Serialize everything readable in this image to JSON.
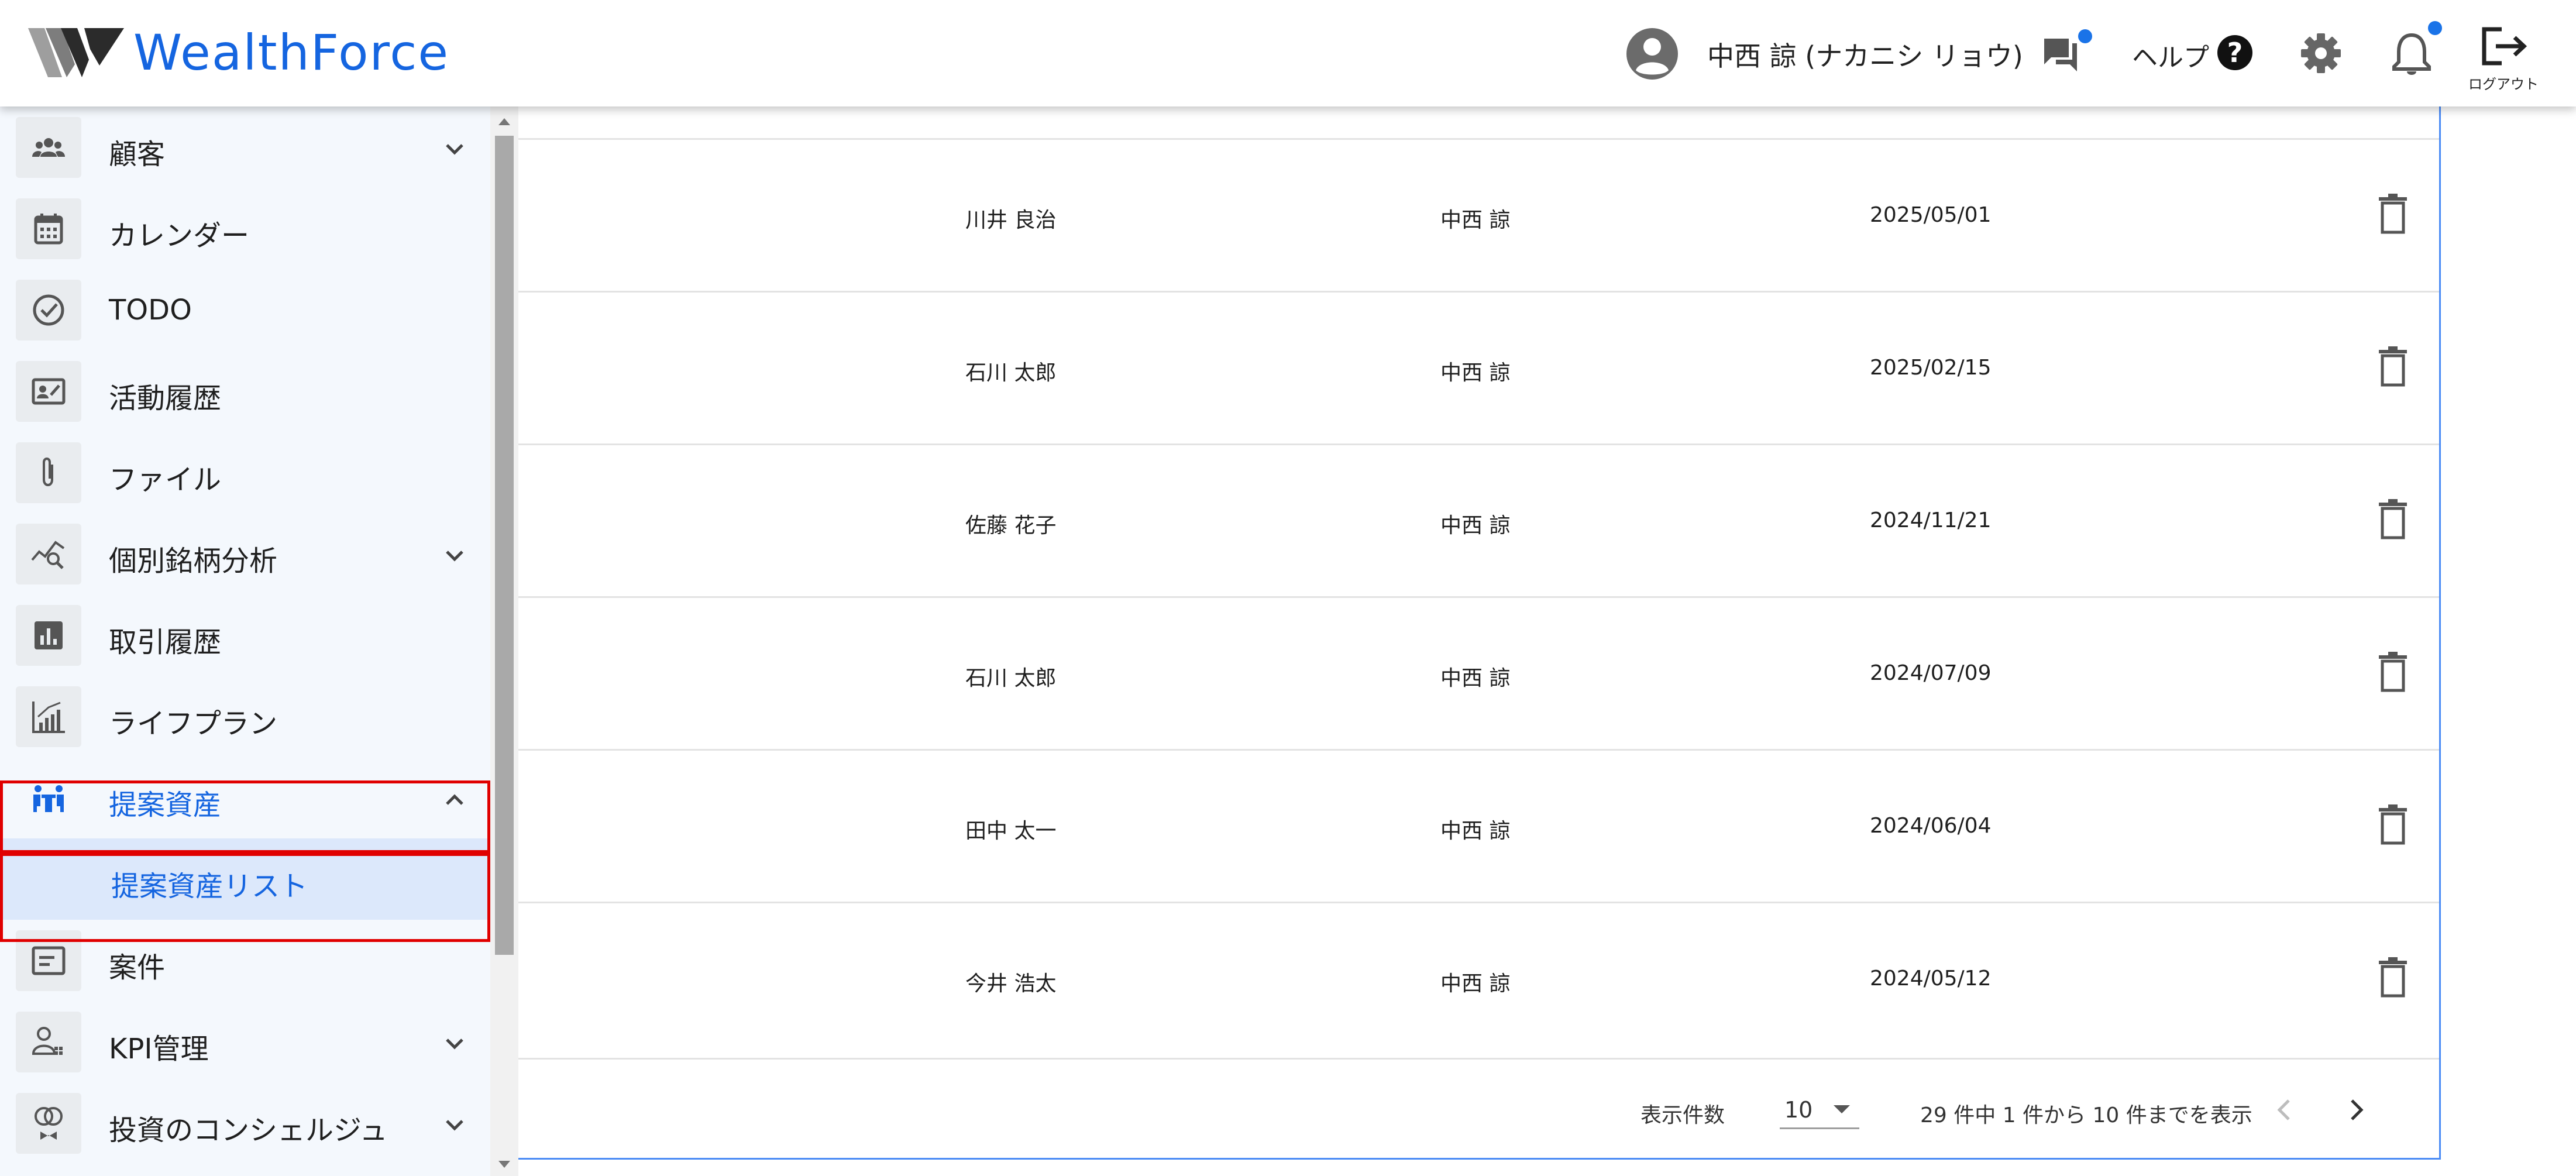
{
  "brand": {
    "name": "WealthForce",
    "colors": {
      "primary": "#1565e0",
      "logo_dark": "#2b2b2b"
    }
  },
  "header": {
    "user_name": "中西 諒 (ナカニシ リョウ)",
    "help_label": "ヘルプ",
    "help_icon_glyph": "?",
    "logout_label": "ログアウト",
    "icons": [
      "account-circle-icon",
      "chat-icon",
      "help-icon",
      "gear-icon",
      "bell-icon",
      "logout-icon"
    ]
  },
  "sidebar": {
    "items": [
      {
        "label": "顧客",
        "icon": "people-icon",
        "expandable": true
      },
      {
        "label": "カレンダー",
        "icon": "calendar-icon",
        "expandable": false
      },
      {
        "label": "TODO",
        "icon": "check-circle-icon",
        "expandable": false
      },
      {
        "label": "活動履歴",
        "icon": "activity-card-icon",
        "expandable": false
      },
      {
        "label": "ファイル",
        "icon": "paperclip-icon",
        "expandable": false
      },
      {
        "label": "個別銘柄分析",
        "icon": "chart-search-icon",
        "expandable": true
      },
      {
        "label": "取引履歴",
        "icon": "bar-chart-icon",
        "expandable": false
      },
      {
        "label": "ライフプラン",
        "icon": "growth-chart-icon",
        "expandable": false
      },
      {
        "label": "提案資産",
        "icon": "meeting-icon",
        "expandable": true,
        "expanded": true
      },
      {
        "label": "提案資産リスト",
        "icon": "",
        "sub": true,
        "selected": true
      },
      {
        "label": "案件",
        "icon": "case-icon",
        "expandable": false
      },
      {
        "label": "KPI管理",
        "icon": "kpi-user-icon",
        "expandable": true
      },
      {
        "label": "投資のコンシェルジュ",
        "icon": "concierge-icon",
        "expandable": true
      }
    ]
  },
  "table": {
    "rows": [
      {
        "customer": "川井 良治",
        "staff": "中西 諒",
        "date": "2025/05/01"
      },
      {
        "customer": "石川 太郎",
        "staff": "中西 諒",
        "date": "2025/02/15"
      },
      {
        "customer": "佐藤 花子",
        "staff": "中西 諒",
        "date": "2024/11/21"
      },
      {
        "customer": "石川 太郎",
        "staff": "中西 諒",
        "date": "2024/07/09"
      },
      {
        "customer": "田中 太一",
        "staff": "中西 諒",
        "date": "2024/06/04"
      },
      {
        "customer": "今井 浩太",
        "staff": "中西 諒",
        "date": "2024/05/12"
      }
    ]
  },
  "pagination": {
    "per_page_label": "表示件数",
    "per_page_value": "10",
    "range_text": "29 件中 1 件から 10 件までを表示"
  }
}
